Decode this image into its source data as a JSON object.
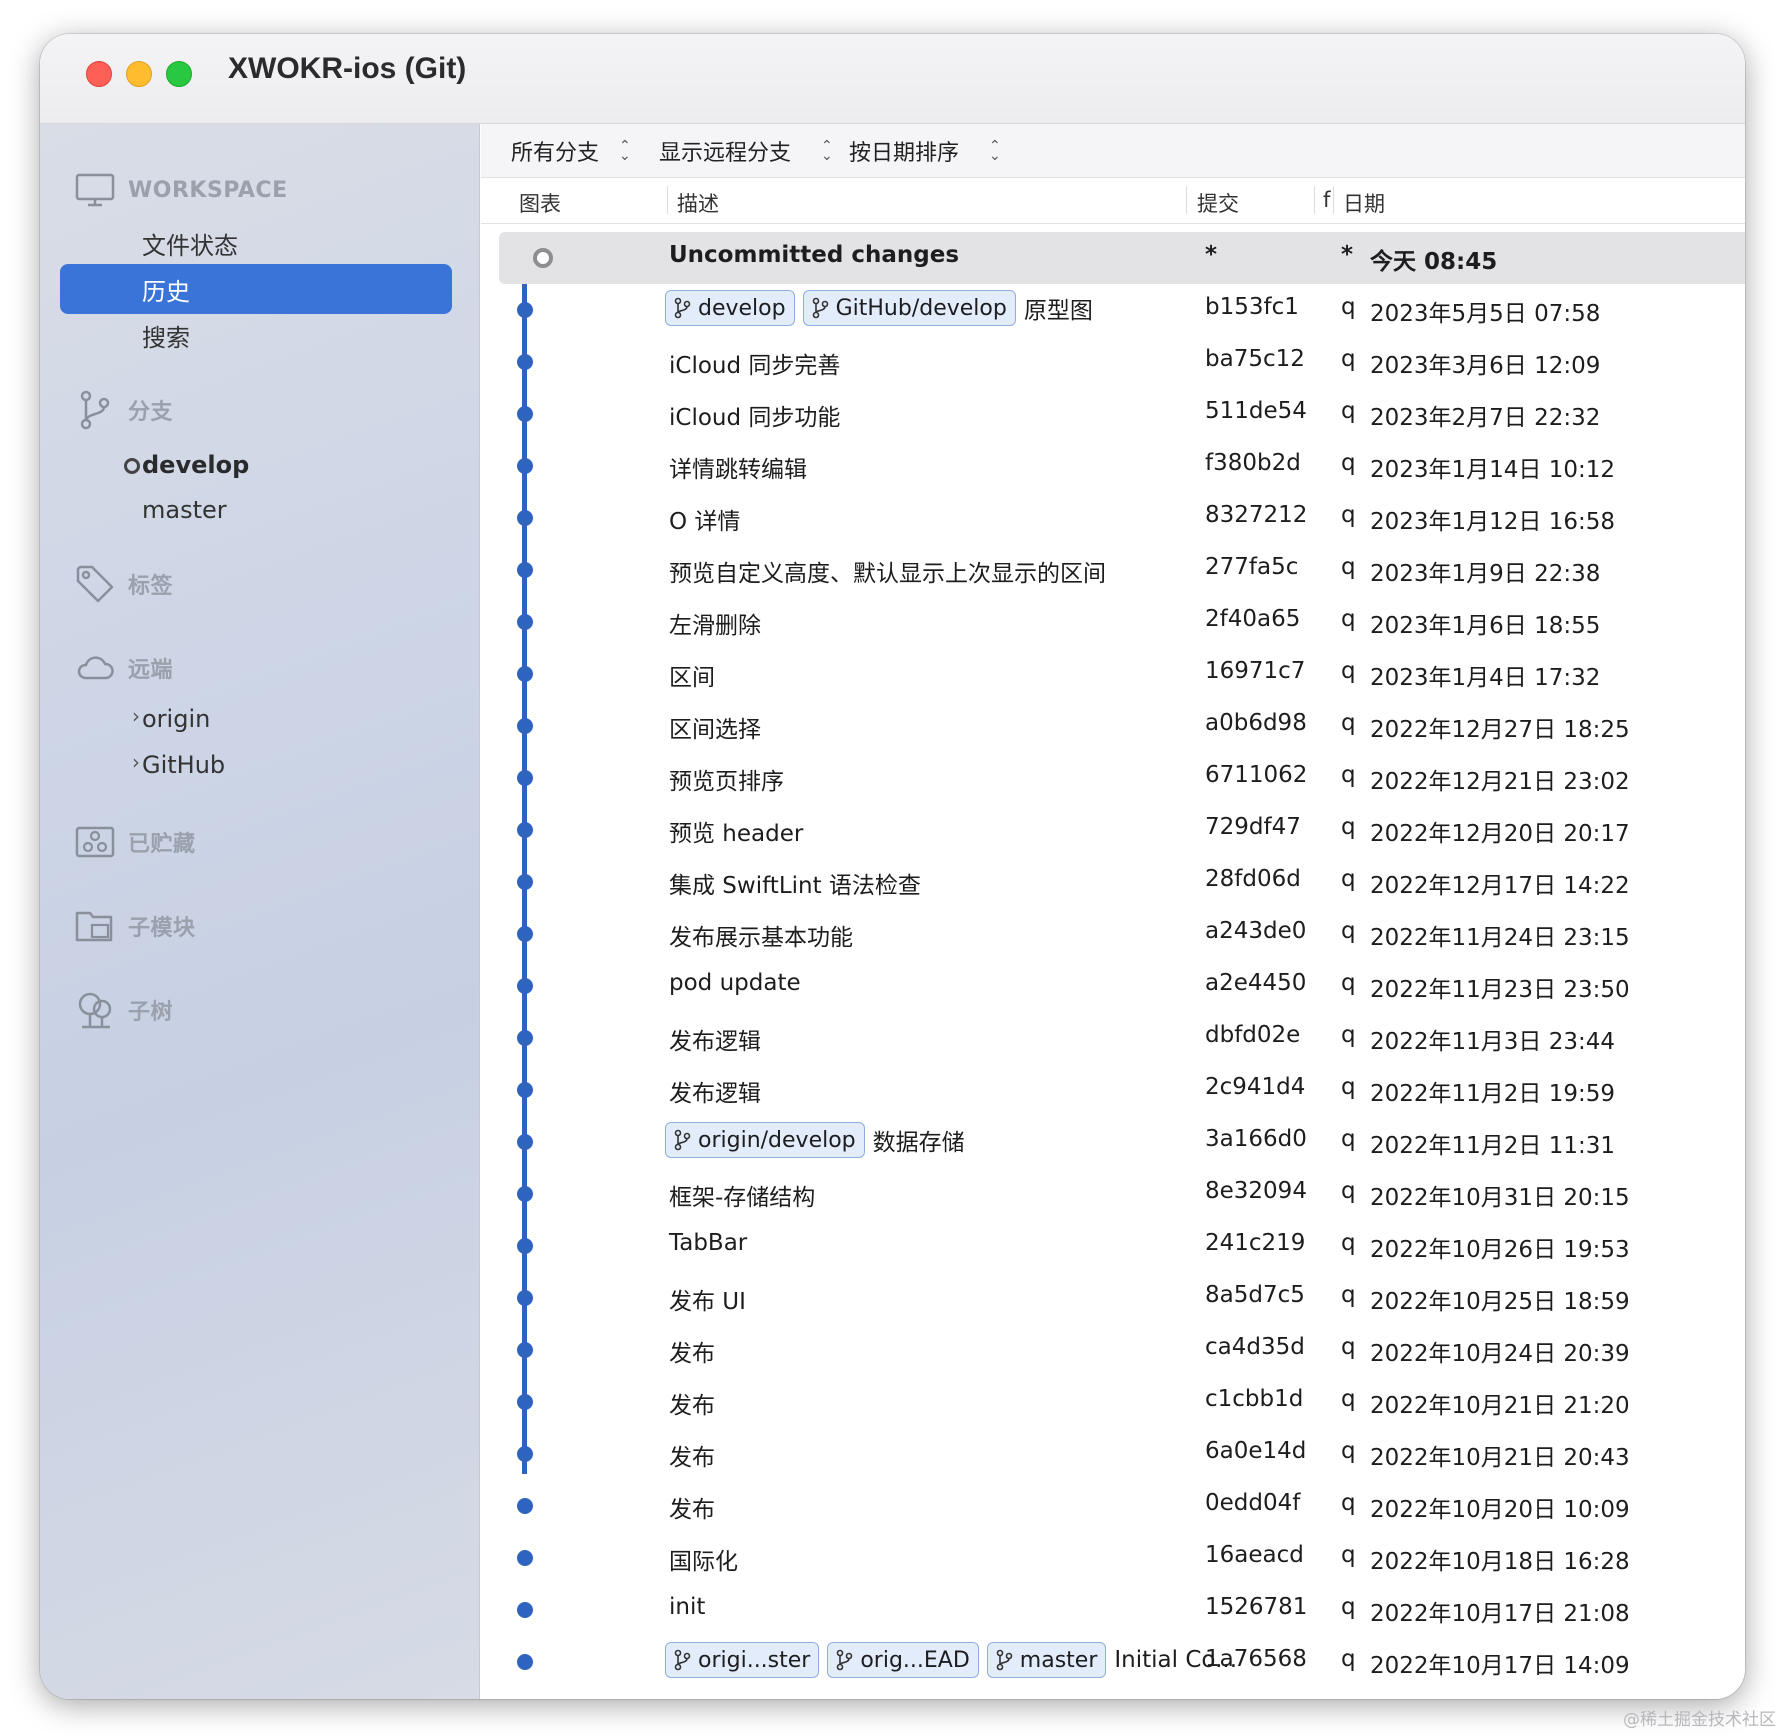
{
  "window": {
    "title": "XWOKR-ios (Git)"
  },
  "sidebar": {
    "workspace": {
      "label": "WORKSPACE",
      "icon": "monitor-icon",
      "items": [
        {
          "label": "文件状态"
        },
        {
          "label": "历史",
          "selected": true
        },
        {
          "label": "搜索"
        }
      ]
    },
    "branches": {
      "label": "分支",
      "icon": "branch-icon",
      "items": [
        {
          "label": "develop",
          "current": true
        },
        {
          "label": "master"
        }
      ]
    },
    "tags": {
      "label": "标签",
      "icon": "tag-icon"
    },
    "remotes": {
      "label": "远端",
      "icon": "cloud-icon",
      "items": [
        {
          "label": "origin"
        },
        {
          "label": "GitHub"
        }
      ]
    },
    "stashes": {
      "label": "已贮藏",
      "icon": "stash-icon"
    },
    "submodules": {
      "label": "子模块",
      "icon": "submodule-icon"
    },
    "subtrees": {
      "label": "子树",
      "icon": "subtree-icon"
    }
  },
  "toolbar": {
    "branch_filter": "所有分支",
    "remote_filter": "显示远程分支",
    "sort": "按日期排序"
  },
  "columns": {
    "graph": "图表",
    "description": "描述",
    "commit": "提交",
    "author": "f",
    "date": "日期"
  },
  "uncommitted": {
    "description": "Uncommitted changes",
    "commit": "*",
    "author": "*",
    "date": "今天 08:45"
  },
  "commits": [
    {
      "tags": [
        "develop",
        "GitHub/develop"
      ],
      "description": "原型图",
      "commit": "b153fc1",
      "author": "q",
      "date": "2023年5月5日 07:58"
    },
    {
      "tags": [],
      "description": "iCloud 同步完善",
      "commit": "ba75c12",
      "author": "q",
      "date": "2023年3月6日 12:09"
    },
    {
      "tags": [],
      "description": "iCloud 同步功能",
      "commit": "511de54",
      "author": "q",
      "date": "2023年2月7日 22:32"
    },
    {
      "tags": [],
      "description": "详情跳转编辑",
      "commit": "f380b2d",
      "author": "q",
      "date": "2023年1月14日 10:12"
    },
    {
      "tags": [],
      "description": "O 详情",
      "commit": "8327212",
      "author": "q",
      "date": "2023年1月12日 16:58"
    },
    {
      "tags": [],
      "description": "预览自定义高度、默认显示上次显示的区间",
      "commit": "277fa5c",
      "author": "q",
      "date": "2023年1月9日 22:38"
    },
    {
      "tags": [],
      "description": "左滑删除",
      "commit": "2f40a65",
      "author": "q",
      "date": "2023年1月6日 18:55"
    },
    {
      "tags": [],
      "description": "区间",
      "commit": "16971c7",
      "author": "q",
      "date": "2023年1月4日 17:32"
    },
    {
      "tags": [],
      "description": "区间选择",
      "commit": "a0b6d98",
      "author": "q",
      "date": "2022年12月27日 18:25"
    },
    {
      "tags": [],
      "description": "预览页排序",
      "commit": "6711062",
      "author": "q",
      "date": "2022年12月21日 23:02"
    },
    {
      "tags": [],
      "description": "预览 header",
      "commit": "729df47",
      "author": "q",
      "date": "2022年12月20日 20:17"
    },
    {
      "tags": [],
      "description": "集成 SwiftLint 语法检查",
      "commit": "28fd06d",
      "author": "q",
      "date": "2022年12月17日 14:22"
    },
    {
      "tags": [],
      "description": "发布展示基本功能",
      "commit": "a243de0",
      "author": "q",
      "date": "2022年11月24日 23:15"
    },
    {
      "tags": [],
      "description": "pod update",
      "commit": "a2e4450",
      "author": "q",
      "date": "2022年11月23日 23:50"
    },
    {
      "tags": [],
      "description": "发布逻辑",
      "commit": "dbfd02e",
      "author": "q",
      "date": "2022年11月3日 23:44"
    },
    {
      "tags": [],
      "description": "发布逻辑",
      "commit": "2c941d4",
      "author": "q",
      "date": "2022年11月2日 19:59"
    },
    {
      "tags": [
        "origin/develop"
      ],
      "description": "数据存储",
      "commit": "3a166d0",
      "author": "q",
      "date": "2022年11月2日 11:31"
    },
    {
      "tags": [],
      "description": "框架-存储结构",
      "commit": "8e32094",
      "author": "q",
      "date": "2022年10月31日 20:15"
    },
    {
      "tags": [],
      "description": "TabBar",
      "commit": "241c219",
      "author": "q",
      "date": "2022年10月26日 19:53"
    },
    {
      "tags": [],
      "description": "发布 UI",
      "commit": "8a5d7c5",
      "author": "q",
      "date": "2022年10月25日 18:59"
    },
    {
      "tags": [],
      "description": "发布",
      "commit": "ca4d35d",
      "author": "q",
      "date": "2022年10月24日 20:39"
    },
    {
      "tags": [],
      "description": "发布",
      "commit": "c1cbb1d",
      "author": "q",
      "date": "2022年10月21日 21:20"
    },
    {
      "tags": [],
      "description": "发布",
      "commit": "6a0e14d",
      "author": "q",
      "date": "2022年10月21日 20:43"
    },
    {
      "tags": [],
      "description": "发布",
      "commit": "0edd04f",
      "author": "q",
      "date": "2022年10月20日 10:09"
    },
    {
      "tags": [],
      "description": "国际化",
      "commit": "16aeacd",
      "author": "q",
      "date": "2022年10月18日 16:28"
    },
    {
      "tags": [],
      "description": "init",
      "commit": "1526781",
      "author": "q",
      "date": "2022年10月17日 21:08"
    },
    {
      "tags": [
        "origi...ster",
        "orig...EAD",
        "master"
      ],
      "description": "Initial Co...",
      "commit": "1a76568",
      "author": "q",
      "date": "2022年10月17日 14:09"
    }
  ],
  "colors": {
    "accent": "#3a74d8",
    "graph": "#2f63c0",
    "tag_bg": "#e3ecfa",
    "tag_border": "#8faee0"
  },
  "watermark": "@稀土掘金技术社区"
}
